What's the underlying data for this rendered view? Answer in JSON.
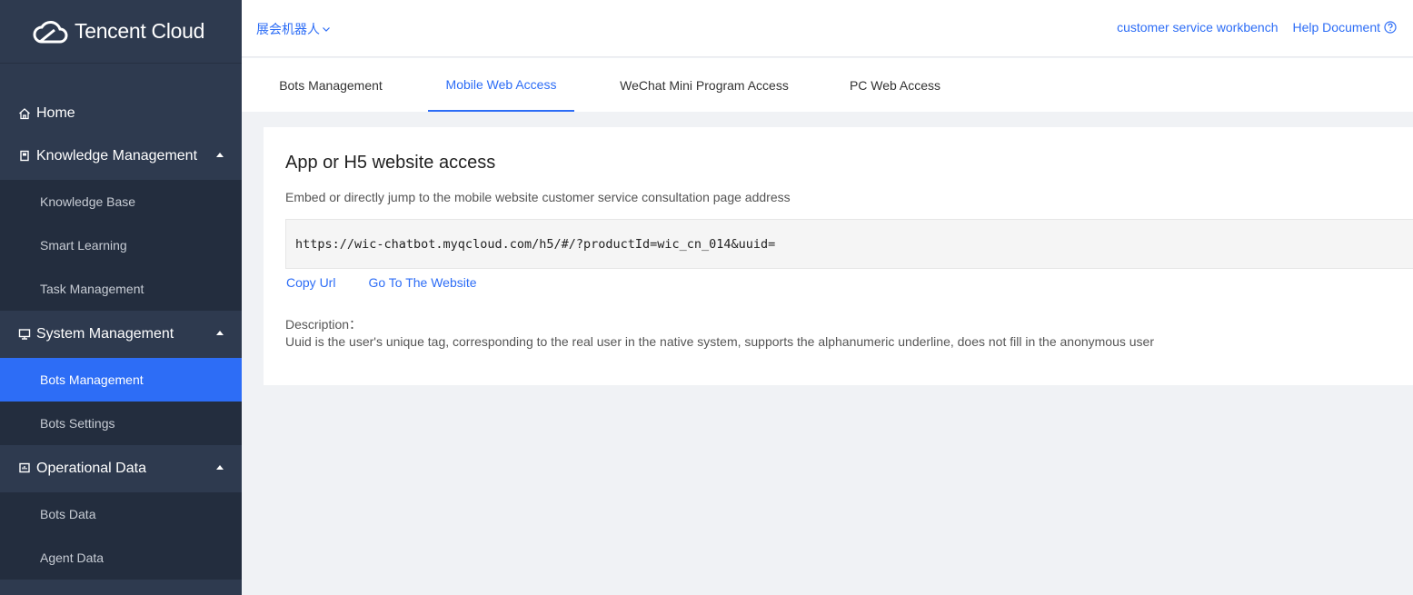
{
  "brand": {
    "name": "Tencent Cloud",
    "icon": "cloud-logo-icon"
  },
  "sidebar": {
    "home": {
      "label": "Home",
      "icon": "home-icon"
    },
    "groups": [
      {
        "label": "Knowledge Management",
        "icon": "book-icon",
        "items": [
          {
            "label": "Knowledge Base"
          },
          {
            "label": "Smart Learning"
          },
          {
            "label": "Task Management"
          }
        ]
      },
      {
        "label": "System Management",
        "icon": "monitor-icon",
        "items": [
          {
            "label": "Bots Management",
            "active": true
          },
          {
            "label": "Bots Settings"
          }
        ]
      },
      {
        "label": "Operational Data",
        "icon": "chart-icon",
        "items": [
          {
            "label": "Bots Data"
          },
          {
            "label": "Agent Data"
          }
        ]
      }
    ]
  },
  "header": {
    "bot_selector": "展会机器人",
    "workbench_link": "customer service workbench",
    "help_link": "Help Document"
  },
  "tabs": [
    {
      "label": "Bots Management"
    },
    {
      "label": "Mobile Web Access",
      "active": true
    },
    {
      "label": "WeChat Mini Program Access"
    },
    {
      "label": "PC Web Access"
    }
  ],
  "card": {
    "title": "App or H5 website access",
    "subtitle": "Embed or directly jump to the mobile website customer service consultation page address",
    "url": "https://wic-chatbot.myqcloud.com/h5/#/?productId=wic_cn_014&uuid=",
    "copy_link": "Copy Url",
    "goto_link": "Go To The Website",
    "description_label": "Description：",
    "description_text": "Uuid is the user's unique tag, corresponding to the real user in the native system, supports the alphanumeric underline, does not fill in the anonymous user"
  },
  "colors": {
    "accent": "#2d6df6",
    "sidebar_bg": "#2e3a4f",
    "sidebar_sub_bg": "#232d3e"
  }
}
